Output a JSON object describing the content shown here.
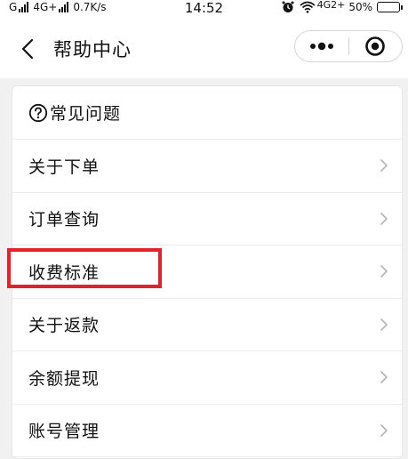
{
  "status_bar": {
    "carrier_left": "G",
    "network": "4G+",
    "speed": "0.7K/s",
    "time": "14:52",
    "net_type": "4G2+",
    "battery_percent": "50%",
    "battery_level": 0.5,
    "icons": [
      "signal-icon",
      "alarm-icon",
      "wifi-icon",
      "battery-icon"
    ]
  },
  "nav": {
    "title": "帮助中心",
    "back_icon": "chevron-left-icon",
    "more_icon": "more-dots-icon",
    "close_icon": "target-close-icon"
  },
  "faq": {
    "header": "常见问题",
    "header_icon": "question-circle-icon",
    "items": [
      {
        "label": "关于下单"
      },
      {
        "label": "订单查询"
      },
      {
        "label": "收费标准"
      },
      {
        "label": "关于返款"
      },
      {
        "label": "余额提现"
      },
      {
        "label": "账号管理"
      }
    ]
  },
  "colors": {
    "highlight": "#e0242c",
    "battery": "#f2c02b",
    "background": "#f1f1f1"
  }
}
